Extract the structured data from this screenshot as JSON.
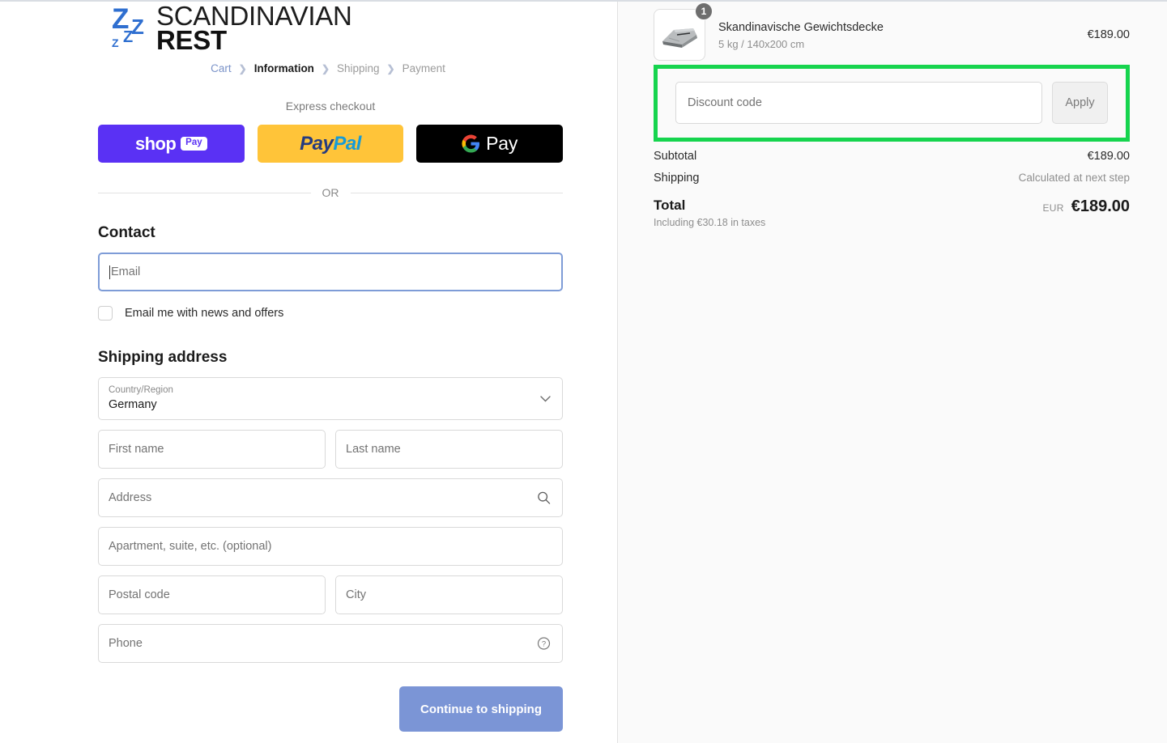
{
  "brand": {
    "logo_line1": "SCANDINAVIAN",
    "logo_line2": "REST",
    "logo_z_glyph": "Z",
    "logo_color": "#2f6fd0"
  },
  "breadcrumb": {
    "cart": "Cart",
    "information": "Information",
    "shipping": "Shipping",
    "payment": "Payment",
    "separator": "❯"
  },
  "express": {
    "label": "Express checkout",
    "buttons": [
      {
        "name": "shop-pay",
        "word": "shop",
        "pill": "Pay",
        "bg": "#5a31f4"
      },
      {
        "name": "paypal",
        "part1": "Pay",
        "part2": "Pal",
        "bg": "#ffc439"
      },
      {
        "name": "google-pay",
        "mark": "G",
        "text": "Pay",
        "bg": "#000000"
      }
    ],
    "or": "OR"
  },
  "contact": {
    "title": "Contact",
    "email_placeholder": "Email",
    "email_value": "",
    "newsletter_label": "Email me with news and offers",
    "newsletter_checked": false
  },
  "shipping_address": {
    "title": "Shipping address",
    "country_label": "Country/Region",
    "country_value": "Germany",
    "first_name_placeholder": "First name",
    "last_name_placeholder": "Last name",
    "address_placeholder": "Address",
    "apartment_placeholder": "Apartment, suite, etc. (optional)",
    "postal_code_placeholder": "Postal code",
    "city_placeholder": "City",
    "phone_placeholder": "Phone"
  },
  "actions": {
    "continue_label": "Continue to shipping",
    "continue_color": "#7b95d6"
  },
  "order_summary": {
    "item": {
      "title": "Skandinavische Gewichtsdecke",
      "variant": "5 kg / 140x200 cm",
      "price": "€189.00",
      "quantity": "1"
    },
    "discount": {
      "placeholder": "Discount code",
      "value": "",
      "apply_label": "Apply",
      "highlight_color": "#16d44e"
    },
    "subtotal_label": "Subtotal",
    "subtotal_value": "€189.00",
    "shipping_label": "Shipping",
    "shipping_value": "Calculated at next step",
    "total_label": "Total",
    "total_currency": "EUR",
    "total_value": "€189.00",
    "tax_note": "Including €30.18 in taxes"
  }
}
